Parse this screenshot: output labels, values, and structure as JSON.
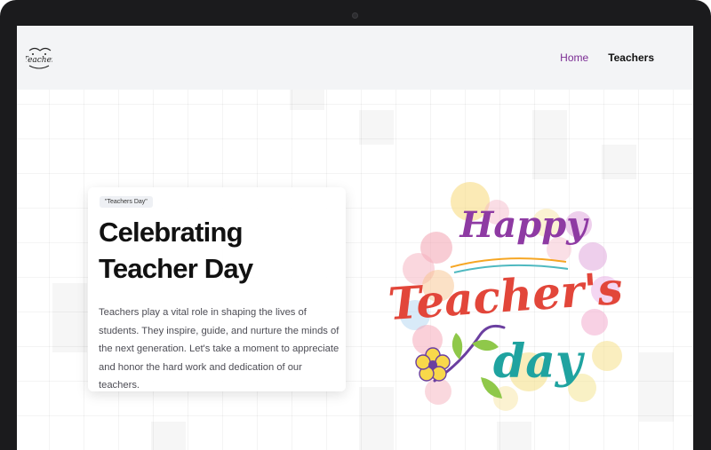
{
  "header": {
    "logo_text": "Teacher",
    "nav": {
      "home": "Home",
      "teachers": "Teachers"
    }
  },
  "hero": {
    "badge": "\"Teachers Day\"",
    "title": "Celebrating Teacher Day",
    "description": "Teachers play a vital role in shaping the lives of students. They inspire, guide, and nurture the minds of the next generation. Let's take a moment to appreciate and honor the hard work and dedication of our teachers."
  },
  "illustration": {
    "line1": "Happy",
    "line2": "Teacher's",
    "line3": "day"
  },
  "colors": {
    "nav_active": "#7b2c94",
    "happy": "#8e3aa3",
    "teachers": "#e2463a",
    "day": "#1fa3a0"
  }
}
